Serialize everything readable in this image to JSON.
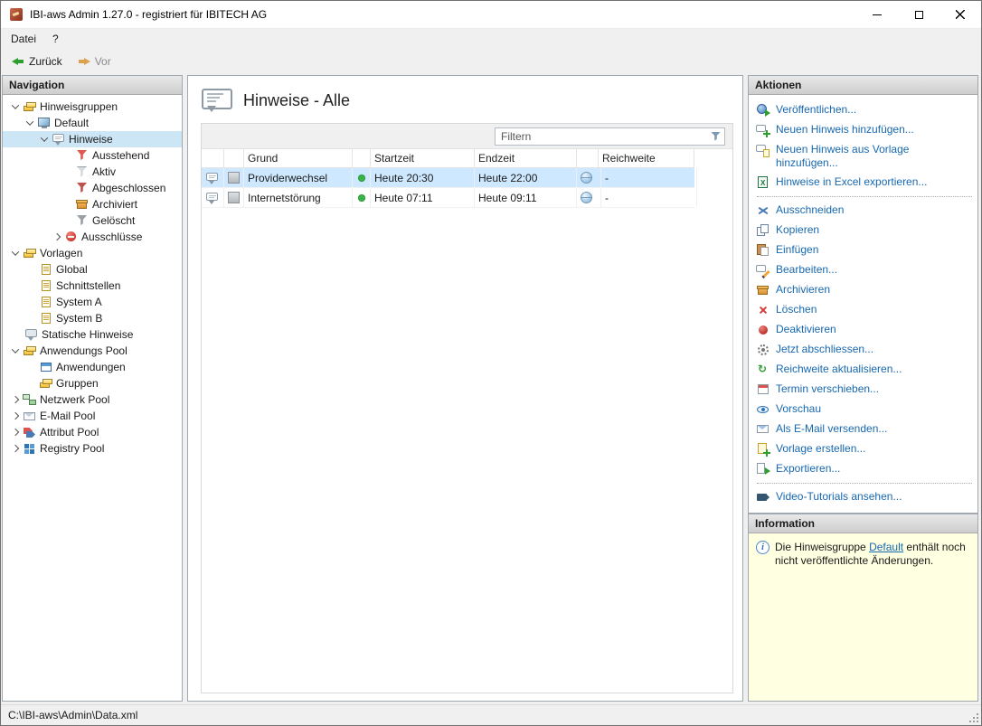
{
  "window": {
    "title": "IBI-aws Admin 1.27.0 - registriert für IBITECH AG"
  },
  "menu": {
    "datei": "Datei",
    "help": "?"
  },
  "toolbar": {
    "back": "Zurück",
    "forward": "Vor"
  },
  "navigation": {
    "header": "Navigation",
    "items": [
      {
        "label": "Hinweisgruppen",
        "icon": "group-icon",
        "level": 0,
        "chevron": "expanded"
      },
      {
        "label": "Default",
        "icon": "computer-icon",
        "level": 1,
        "chevron": "expanded"
      },
      {
        "label": "Hinweise",
        "icon": "hinweis-bubble-icon",
        "level": 2,
        "chevron": "expanded",
        "selected": true
      },
      {
        "label": "Ausstehend",
        "icon": "funnel-icon",
        "level": 4
      },
      {
        "label": "Aktiv",
        "icon": "funnel-icon",
        "level": 4
      },
      {
        "label": "Abgeschlossen",
        "icon": "funnel-icon",
        "level": 4
      },
      {
        "label": "Archiviert",
        "icon": "archive-icon",
        "level": 4
      },
      {
        "label": "Gelöscht",
        "icon": "funnel-icon",
        "level": 4
      },
      {
        "label": "Ausschlüsse",
        "icon": "no-entry-icon",
        "level": 3,
        "chevron": "collapsed"
      },
      {
        "label": "Vorlagen",
        "icon": "group-icon",
        "level": 0,
        "chevron": "expanded"
      },
      {
        "label": "Global",
        "icon": "template-page-icon",
        "level": 1
      },
      {
        "label": "Schnittstellen",
        "icon": "template-page-icon",
        "level": 1
      },
      {
        "label": "System A",
        "icon": "template-page-icon",
        "level": 1
      },
      {
        "label": "System B",
        "icon": "template-page-icon",
        "level": 1
      },
      {
        "label": "Statische Hinweise",
        "icon": "static-note-icon",
        "level": 0
      },
      {
        "label": "Anwendungs Pool",
        "icon": "group-icon",
        "level": 0,
        "chevron": "expanded"
      },
      {
        "label": "Anwendungen",
        "icon": "app-window-icon",
        "level": 1
      },
      {
        "label": "Gruppen",
        "icon": "group-icon",
        "level": 1
      },
      {
        "label": "Netzwerk Pool",
        "icon": "network-icon",
        "level": 0,
        "chevron": "collapsed"
      },
      {
        "label": "E-Mail Pool",
        "icon": "mail-icon",
        "level": 0,
        "chevron": "collapsed"
      },
      {
        "label": "Attribut Pool",
        "icon": "attribute-tag-icon",
        "level": 0,
        "chevron": "collapsed"
      },
      {
        "label": "Registry Pool",
        "icon": "registry-grid-icon",
        "level": 0,
        "chevron": "collapsed"
      }
    ]
  },
  "content": {
    "title": "Hinweise - Alle",
    "filter": {
      "placeholder": "Filtern"
    },
    "table": {
      "headers": {
        "grund": "Grund",
        "startzeit": "Startzeit",
        "endzeit": "Endzeit",
        "reichweite": "Reichweite"
      },
      "rows": [
        {
          "grund": "Providerwechsel",
          "startzeit": "Heute 20:30",
          "endzeit": "Heute 22:00",
          "reichweite": "-",
          "selected": true
        },
        {
          "grund": "Internetstörung",
          "startzeit": "Heute 07:11",
          "endzeit": "Heute 09:11",
          "reichweite": "-",
          "selected": false
        }
      ]
    }
  },
  "actions": {
    "header": "Aktionen",
    "items": [
      {
        "label": "Veröffentlichen...",
        "icon": "publish-icon"
      },
      {
        "label": "Neuen Hinweis hinzufügen...",
        "icon": "add-hinweis-icon"
      },
      {
        "label": "Neuen Hinweis aus Vorlage hinzufügen...",
        "icon": "hinweis-from-template-icon"
      },
      {
        "label": "Hinweise in Excel exportieren...",
        "icon": "excel-icon"
      },
      {
        "label": "Ausschneiden",
        "icon": "cut-icon"
      },
      {
        "label": "Kopieren",
        "icon": "copy-icon"
      },
      {
        "label": "Einfügen",
        "icon": "paste-icon"
      },
      {
        "label": "Bearbeiten...",
        "icon": "edit-icon"
      },
      {
        "label": "Archivieren",
        "icon": "archive-icon"
      },
      {
        "label": "Löschen",
        "icon": "delete-icon"
      },
      {
        "label": "Deaktivieren",
        "icon": "deactivate-icon"
      },
      {
        "label": "Jetzt abschliessen...",
        "icon": "finish-icon"
      },
      {
        "label": "Reichweite aktualisieren...",
        "icon": "refresh-icon"
      },
      {
        "label": "Termin verschieben...",
        "icon": "calendar-icon"
      },
      {
        "label": "Vorschau",
        "icon": "preview-icon"
      },
      {
        "label": "Als E-Mail versenden...",
        "icon": "send-mail-icon"
      },
      {
        "label": "Vorlage erstellen...",
        "icon": "create-template-icon"
      },
      {
        "label": "Exportieren...",
        "icon": "export-icon"
      },
      {
        "label": "Video-Tutorials ansehen...",
        "icon": "video-icon"
      }
    ]
  },
  "information": {
    "header": "Information",
    "text_before": "Die Hinweisgruppe ",
    "link": "Default",
    "text_after": " enthält noch nicht veröffentlichte Änderungen."
  },
  "statusbar": {
    "path": "C:\\IBI-aws\\Admin\\Data.xml"
  },
  "colors": {
    "accent_link": "#1768b0",
    "selection": "#cde8ff",
    "info_bg": "#ffffe1",
    "active_dot": "#3db14a"
  }
}
